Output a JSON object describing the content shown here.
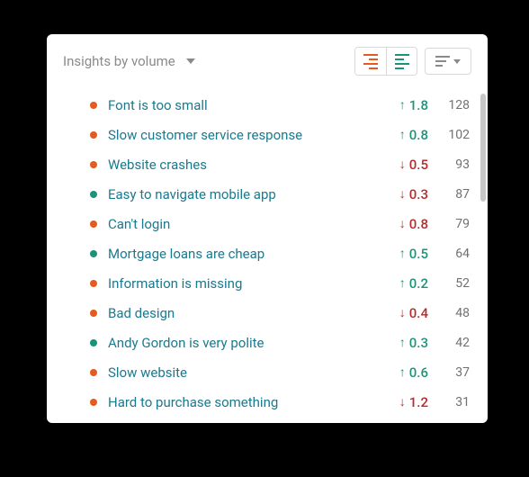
{
  "header": {
    "title": "Insights by volume"
  },
  "rows": [
    {
      "sentiment": "neg",
      "label": "Font is too small",
      "dir": "up",
      "delta": "1.8",
      "count": "128"
    },
    {
      "sentiment": "neg",
      "label": "Slow customer service response",
      "dir": "up",
      "delta": "0.8",
      "count": "102"
    },
    {
      "sentiment": "neg",
      "label": "Website crashes",
      "dir": "down",
      "delta": "0.5",
      "count": "93"
    },
    {
      "sentiment": "pos",
      "label": "Easy to navigate mobile app",
      "dir": "down",
      "delta": "0.3",
      "count": "87"
    },
    {
      "sentiment": "neg",
      "label": "Can't login",
      "dir": "down",
      "delta": "0.8",
      "count": "79"
    },
    {
      "sentiment": "pos",
      "label": "Mortgage loans are cheap",
      "dir": "up",
      "delta": "0.5",
      "count": "64"
    },
    {
      "sentiment": "neg",
      "label": "Information is missing",
      "dir": "up",
      "delta": "0.2",
      "count": "52"
    },
    {
      "sentiment": "neg",
      "label": "Bad design",
      "dir": "down",
      "delta": "0.4",
      "count": "48"
    },
    {
      "sentiment": "pos",
      "label": "Andy Gordon is very polite",
      "dir": "up",
      "delta": "0.3",
      "count": "42"
    },
    {
      "sentiment": "neg",
      "label": "Slow website",
      "dir": "up",
      "delta": "0.6",
      "count": "37"
    },
    {
      "sentiment": "neg",
      "label": "Hard to purchase something",
      "dir": "down",
      "delta": "1.2",
      "count": "31"
    }
  ]
}
